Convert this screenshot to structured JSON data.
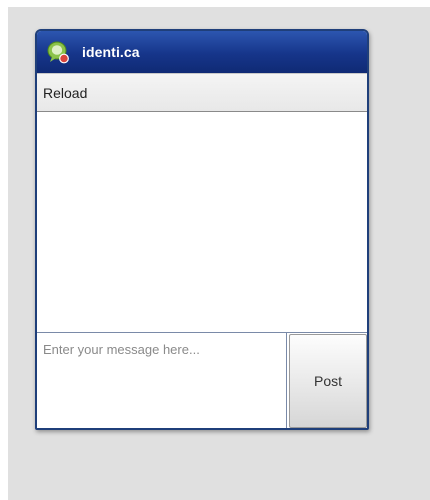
{
  "app": {
    "title": "identi.ca",
    "logo_icon": "speech-bubble-logo-icon",
    "titlebar_color": "#16358a",
    "accent_logo_green": "#8bc34a",
    "accent_logo_red": "#d9453d"
  },
  "toolbar": {
    "reload_label": "Reload"
  },
  "timeline": {
    "items": []
  },
  "compose": {
    "placeholder": "Enter your message here...",
    "value": "",
    "post_label": "Post"
  }
}
